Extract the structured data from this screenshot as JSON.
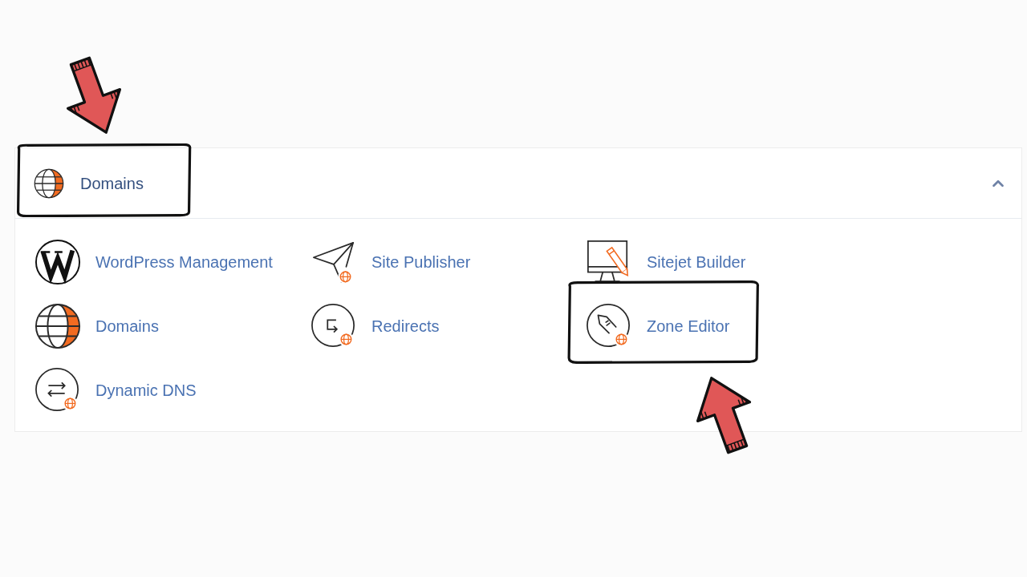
{
  "section": {
    "title": "Domains",
    "expanded": true,
    "highlighted": true
  },
  "tools": [
    {
      "label": "WordPress Management",
      "kind": "wordpress",
      "highlighted": false
    },
    {
      "label": "Site Publisher",
      "kind": "publisher",
      "highlighted": false
    },
    {
      "label": "Sitejet Builder",
      "kind": "builder",
      "highlighted": false
    },
    {
      "label": "Domains",
      "kind": "domains",
      "highlighted": false
    },
    {
      "label": "Redirects",
      "kind": "redirects",
      "highlighted": false
    },
    {
      "label": "Zone Editor",
      "kind": "zone_editor",
      "highlighted": true
    },
    {
      "label": "Dynamic DNS",
      "kind": "dynamic_dns",
      "highlighted": false
    }
  ]
}
